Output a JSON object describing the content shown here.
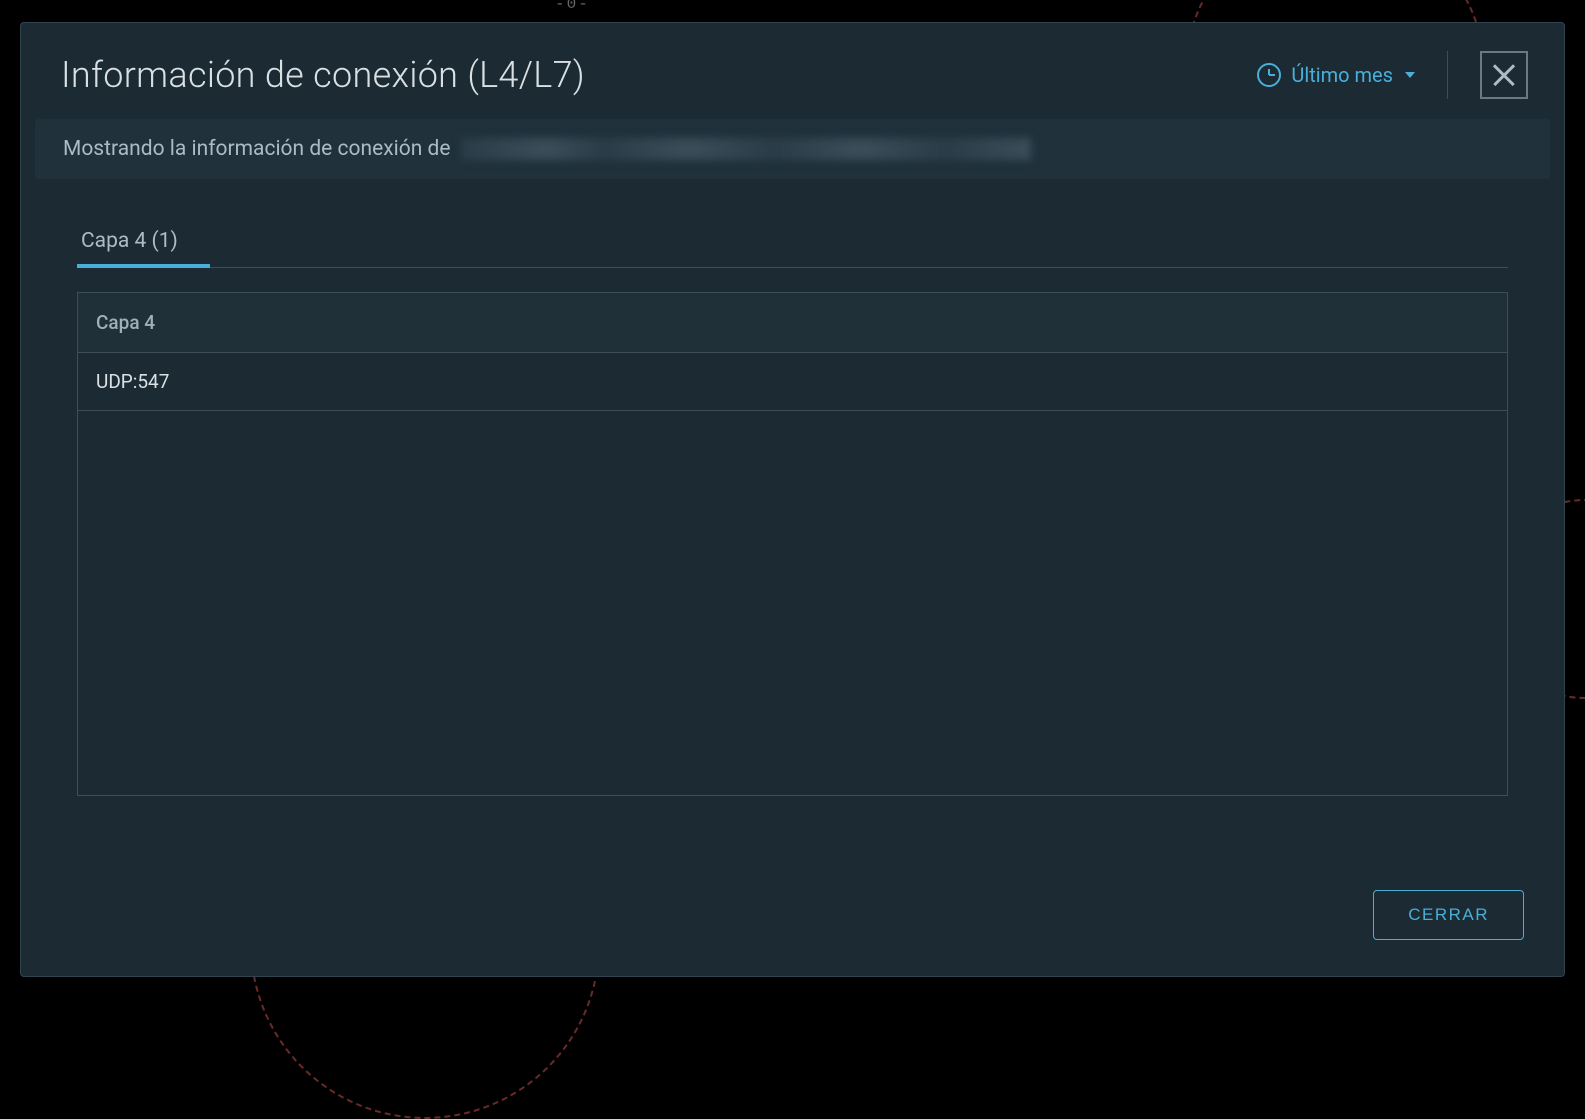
{
  "modal": {
    "title": "Información de conexión (L4/L7)",
    "timeframe_label": "Último mes",
    "info_banner_prefix": "Mostrando la información de conexión de"
  },
  "tabs": [
    {
      "label": "Capa 4 (1)",
      "active": true
    }
  ],
  "table": {
    "header": "Capa 4",
    "rows": [
      "UDP:547"
    ]
  },
  "footer": {
    "close_label": "CERRAR"
  }
}
